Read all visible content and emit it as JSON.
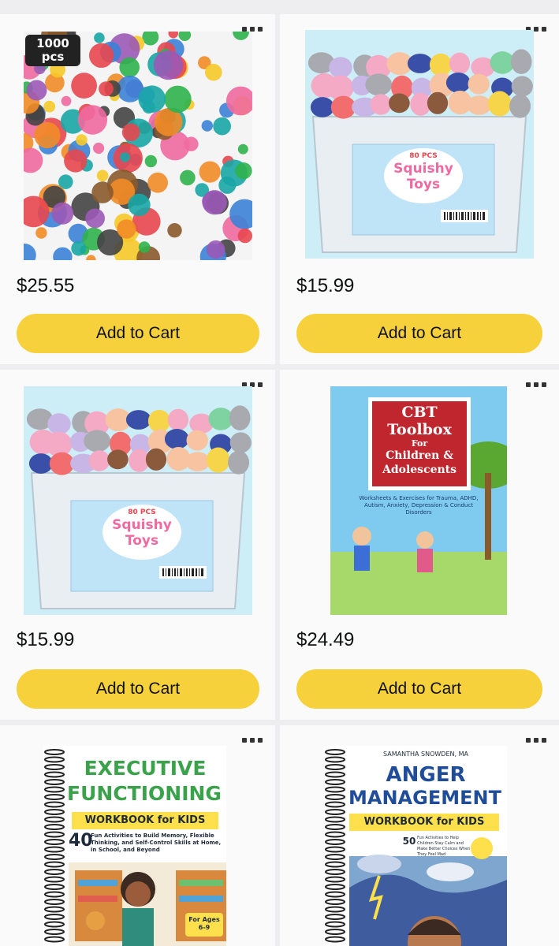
{
  "products": [
    {
      "price": "$25.55",
      "cta": "Add to Cart",
      "more_icon": "more-options-icon",
      "badge": "1000 pcs",
      "image": "assorted-toys-collage"
    },
    {
      "price": "$15.99",
      "cta": "Add to Cart",
      "more_icon": "more-options-icon",
      "box_count": "80 PCS",
      "box_title_1": "Squishy",
      "box_title_2": "Toys",
      "image": "squishy-toys-box"
    },
    {
      "price": "$15.99",
      "cta": "Add to Cart",
      "more_icon": "more-options-icon",
      "box_count": "80 PCS",
      "box_title_1": "Squishy",
      "box_title_2": "Toys",
      "image": "squishy-toys-box"
    },
    {
      "price": "$24.49",
      "cta": "Add to Cart",
      "more_icon": "more-options-icon",
      "title_1": "CBT",
      "title_2": "Toolbox",
      "title_3": "For",
      "title_4": "Children &",
      "title_5": "Adolescents",
      "subtitle": "Worksheets & Exercises for Trauma, ADHD, Autism, Anxiety, Depression & Conduct Disorders",
      "image": "cbt-toolbox-book"
    },
    {
      "title_1": "EXECUTIVE",
      "title_2": "FUNCTIONING",
      "title_3": "WORKBOOK for KIDS",
      "num": "40",
      "subtitle": "Fun Activities to Build Memory, Flexible Thinking, and Self-Control Skills at Home, in School, and Beyond",
      "ages": "For Ages 6-9",
      "more_icon": "more-options-icon",
      "image": "executive-functioning-workbook"
    },
    {
      "author": "SAMANTHA SNOWDEN, MA",
      "title_1": "ANGER",
      "title_2": "MANAGEMENT",
      "title_3": "WORKBOOK for KIDS",
      "num": "50",
      "subtitle": "Fun Activities to Help Children Stay Calm and Make Better Choices When They Feel Mad",
      "more_icon": "more-options-icon",
      "image": "anger-management-workbook"
    }
  ],
  "colors": {
    "button": "#f7d13c",
    "page": "#eeeef0",
    "card": "#fafafb"
  }
}
